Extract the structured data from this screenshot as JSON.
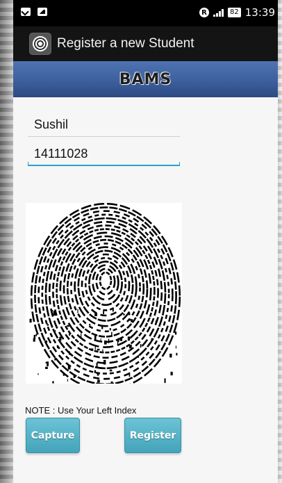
{
  "status_bar": {
    "icons_left": [
      "mail-icon",
      "image-icon"
    ],
    "r_badge": "R",
    "battery": "82",
    "time": "13:39"
  },
  "action_bar": {
    "title": "Register a new Student",
    "icon": "fingerprint-app-icon"
  },
  "banner": {
    "text": "BAMS"
  },
  "form": {
    "name_value": "Sushil",
    "roll_value": "14111028"
  },
  "fingerprint": {
    "icon": "fingerprint-image"
  },
  "note": "NOTE : Use Your Left Index",
  "buttons": {
    "capture": "Capture",
    "register": "Register"
  },
  "colors": {
    "banner": "#3d5f9e",
    "button": "#4aaac0",
    "focus_underline": "#2a9fc8"
  }
}
